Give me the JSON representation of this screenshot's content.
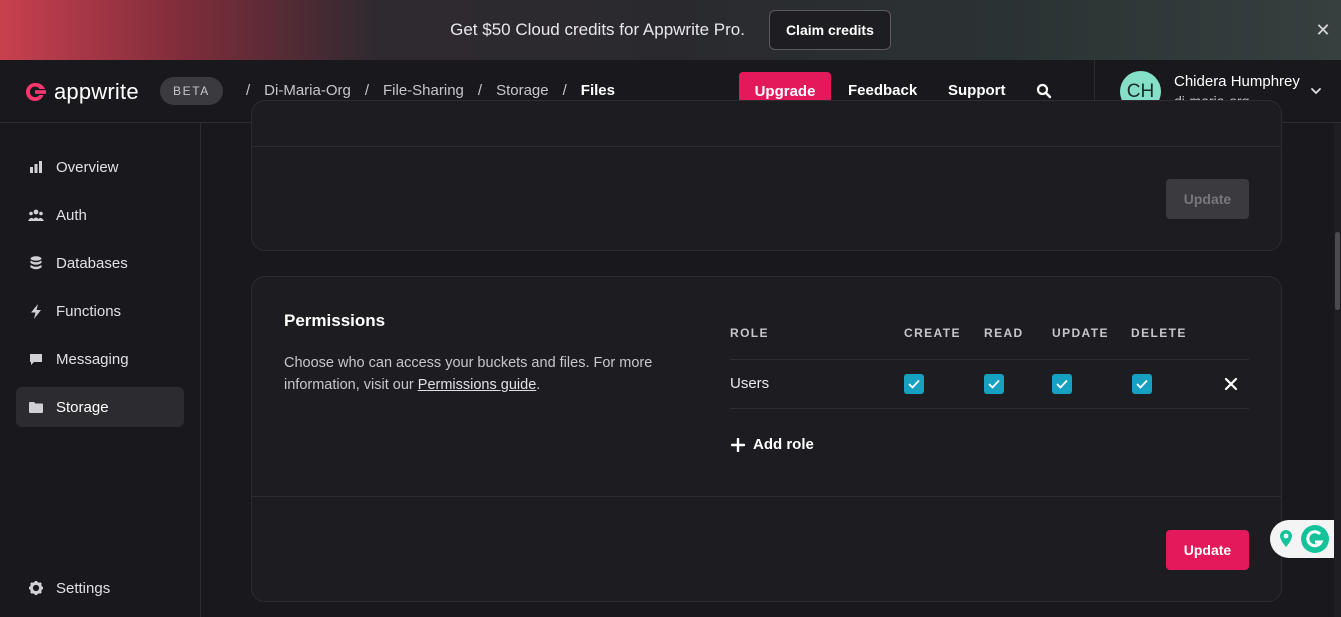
{
  "banner": {
    "text": "Get $50 Cloud credits for Appwrite Pro.",
    "cta_label": "Claim credits",
    "close_label": "✕"
  },
  "header": {
    "logo_text": "appwrite",
    "badge": "BETA",
    "breadcrumb": [
      {
        "label": "Di-Maria-Org"
      },
      {
        "label": "File-Sharing"
      },
      {
        "label": "Storage"
      },
      {
        "label": "Files"
      }
    ],
    "separator": "/",
    "upgrade_label": "Upgrade",
    "feedback_label": "Feedback",
    "support_label": "Support",
    "user": {
      "initials": "CH",
      "name": "Chidera Humphrey",
      "org": "di-maria-org"
    }
  },
  "sidebar": {
    "items": [
      {
        "label": "Overview",
        "icon": "chart-icon"
      },
      {
        "label": "Auth",
        "icon": "users-icon"
      },
      {
        "label": "Databases",
        "icon": "database-icon"
      },
      {
        "label": "Functions",
        "icon": "bolt-icon"
      },
      {
        "label": "Messaging",
        "icon": "chat-icon"
      },
      {
        "label": "Storage",
        "icon": "folder-icon",
        "active": true
      }
    ],
    "settings_label": "Settings"
  },
  "top_card": {
    "update_label": "Update"
  },
  "permissions": {
    "title": "Permissions",
    "description": "Choose who can access your buckets and files. For more information, visit our",
    "link_text": "Permissions guide",
    "description_end": ".",
    "columns": [
      "ROLE",
      "CREATE",
      "READ",
      "UPDATE",
      "DELETE"
    ],
    "rows": [
      {
        "role": "Users",
        "create": true,
        "read": true,
        "update": true,
        "delete": true
      }
    ],
    "add_role_label": "Add role",
    "update_label": "Update"
  },
  "colors": {
    "accent": "#e3195b",
    "checkbox": "#16a1c3",
    "background": "#19191d",
    "card": "#1d1d21"
  }
}
